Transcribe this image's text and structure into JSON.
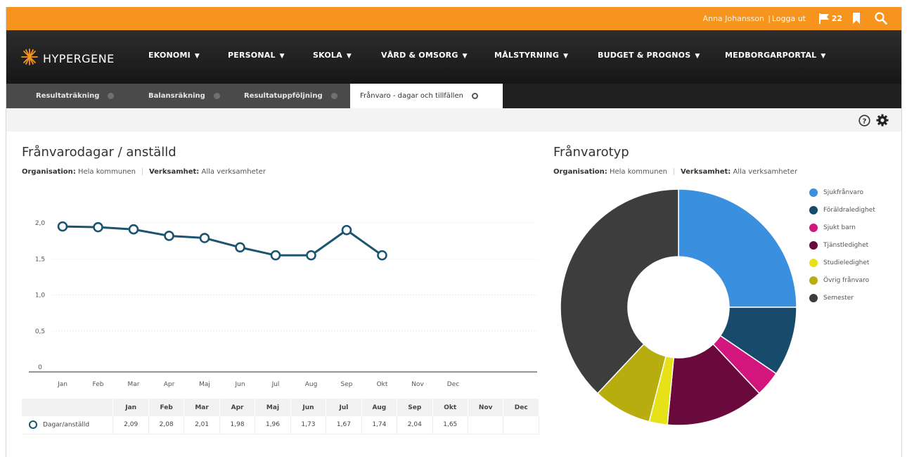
{
  "topbar": {
    "user_name": "Anna Johansson",
    "separator": "|",
    "logout_label": "Logga ut",
    "flag_count": "22",
    "icons": [
      "flag-icon",
      "bookmark-icon",
      "search-icon"
    ]
  },
  "brand": {
    "name": "HYPERGENE",
    "logo_color": "#f7941d"
  },
  "nav": {
    "items": [
      {
        "label": "EKONOMI"
      },
      {
        "label": "PERSONAL"
      },
      {
        "label": "SKOLA"
      },
      {
        "label": "VÅRD & OMSORG"
      },
      {
        "label": "MÅLSTYRNING"
      },
      {
        "label": "BUDGET & PROGNOS"
      },
      {
        "label": "MEDBORGARPORTAL"
      }
    ]
  },
  "tabs": [
    {
      "label": "Resultaträkning",
      "active": false
    },
    {
      "label": "Balansräkning",
      "active": false
    },
    {
      "label": "Resultatuppföljning",
      "active": false
    },
    {
      "label": "Frånvaro - dagar och tillfällen",
      "active": true
    }
  ],
  "toolbar": {
    "icons": [
      "help-icon",
      "gear-icon"
    ]
  },
  "left_panel": {
    "title": "Frånvarodagar / anställd",
    "org_label": "Organisation:",
    "org_value": "Hela kommunen",
    "business_label": "Verksamhet:",
    "business_value": "Alla verksamheter"
  },
  "right_panel": {
    "title": "Frånvarotyp",
    "org_label": "Organisation:",
    "org_value": "Hela kommunen",
    "business_label": "Verksamhet:",
    "business_value": "Alla verksamheter"
  },
  "chart_data": [
    {
      "type": "line",
      "categories": [
        "Jan",
        "Feb",
        "Mar",
        "Apr",
        "Maj",
        "Jun",
        "Jul",
        "Aug",
        "Sep",
        "Okt",
        "Nov",
        "Dec"
      ],
      "series": [
        {
          "name": "Dagar/anställd",
          "values": [
            1.95,
            1.94,
            1.91,
            1.82,
            1.79,
            1.66,
            1.55,
            1.55,
            1.9,
            1.55,
            null,
            null
          ],
          "color": "#1b5470"
        }
      ],
      "yticks": [
        "2,0",
        "1,5",
        "1,0",
        "0,5",
        "0"
      ],
      "ylim": [
        0,
        2
      ],
      "grid": true
    },
    {
      "type": "pie",
      "donut": true,
      "slices": [
        {
          "name": "Sjukfrånvaro",
          "value": 25,
          "color": "#3a8fde"
        },
        {
          "name": "Föräldraledighet",
          "value": 9.5,
          "color": "#184a6c"
        },
        {
          "name": "Sjukt barn",
          "value": 3.5,
          "color": "#d3157e"
        },
        {
          "name": "Tjänstledighet",
          "value": 13.5,
          "color": "#6a0a3c"
        },
        {
          "name": "Studieledighet",
          "value": 2.5,
          "color": "#e6e119"
        },
        {
          "name": "Övrig frånvaro",
          "value": 8,
          "color": "#b8ad0e"
        },
        {
          "name": "Semester",
          "value": 38,
          "color": "#3d3d3d"
        }
      ],
      "legend_position": "right"
    }
  ],
  "table": {
    "headers": [
      "",
      "Jan",
      "Feb",
      "Mar",
      "Apr",
      "Maj",
      "Jun",
      "Jul",
      "Aug",
      "Sep",
      "Okt",
      "Nov",
      "Dec"
    ],
    "rows": [
      {
        "label": "Dagar/anställd",
        "cells": [
          "2,09",
          "2,08",
          "2,01",
          "1,98",
          "1,96",
          "1,73",
          "1,67",
          "1,74",
          "2,04",
          "1,65",
          "",
          ""
        ]
      }
    ]
  }
}
